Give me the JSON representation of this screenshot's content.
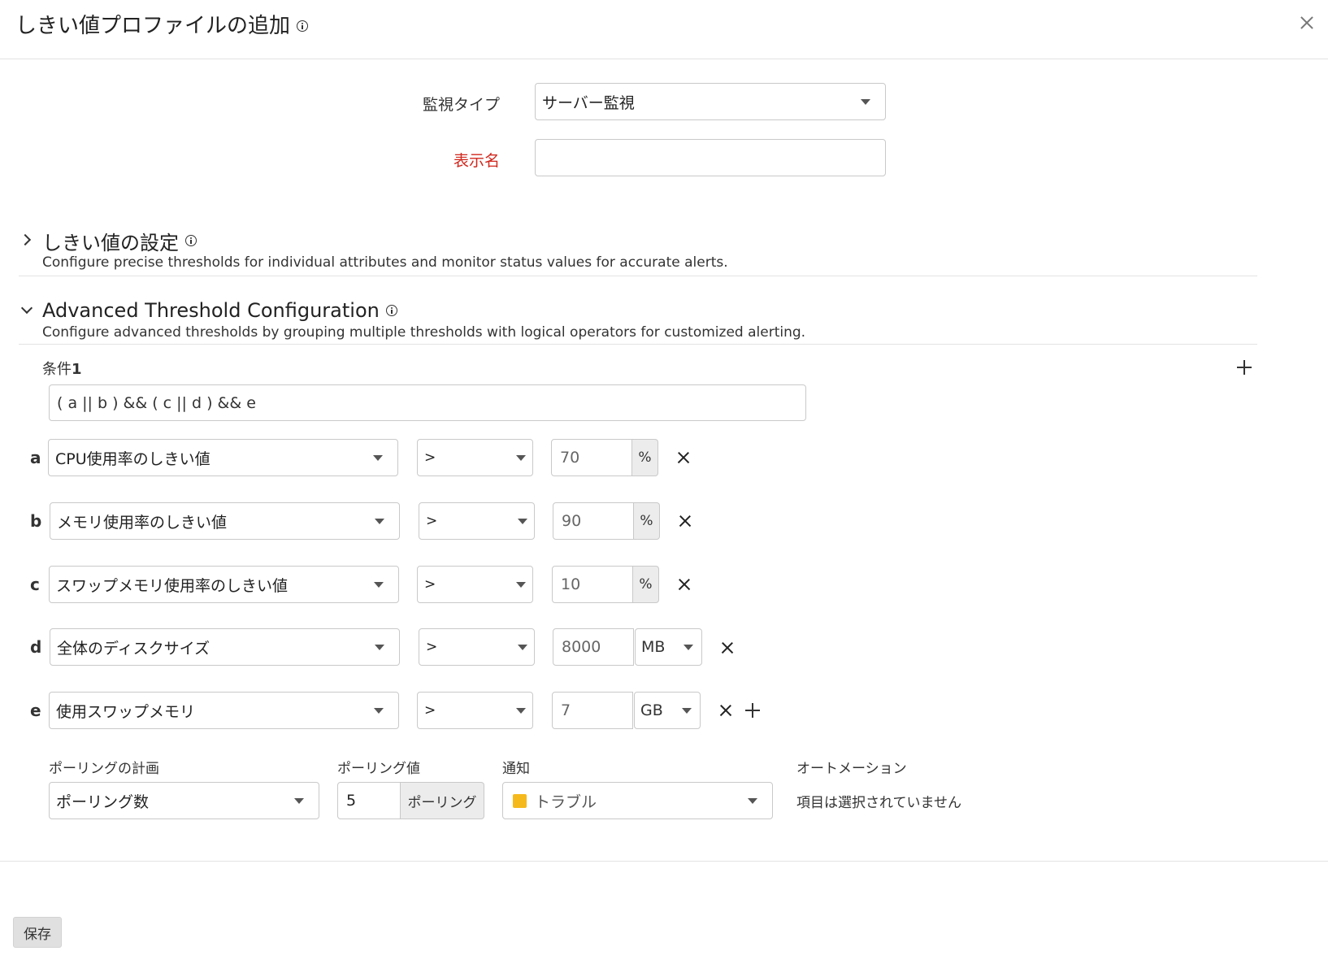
{
  "dialog": {
    "title": "しきい値プロファイルの追加",
    "close_icon": "close-icon"
  },
  "form": {
    "monitor_type_label": "監視タイプ",
    "monitor_type_value": "サーバー監視",
    "display_name_label": "表示名",
    "display_name_value": "",
    "label_required_color": "#d0261c"
  },
  "sections": {
    "threshold": {
      "title": "しきい値の設定",
      "desc": "Configure precise thresholds for individual attributes and monitor status values for accurate alerts."
    },
    "advanced": {
      "title": "Advanced Threshold Configuration",
      "desc": "Configure advanced thresholds by grouping multiple thresholds with logical operators for customized alerting."
    }
  },
  "condition": {
    "label": "条件",
    "number": "1",
    "expression": "( a || b ) && ( c || d ) && e"
  },
  "rows": [
    {
      "key": "a",
      "attribute": "CPU使用率のしきい値",
      "operator": ">",
      "value": "70",
      "unit": "%"
    },
    {
      "key": "b",
      "attribute": "メモリ使用率のしきい値",
      "operator": ">",
      "value": "90",
      "unit": "%"
    },
    {
      "key": "c",
      "attribute": "スワップメモリ使用率のしきい値",
      "operator": ">",
      "value": "10",
      "unit": "%"
    },
    {
      "key": "d",
      "attribute": "全体のディスクサイズ",
      "operator": ">",
      "value": "8000",
      "unit": "MB"
    },
    {
      "key": "e",
      "attribute": "使用スワップメモリ",
      "operator": ">",
      "value": "7",
      "unit": "GB"
    }
  ],
  "polling": {
    "plan_label": "ポーリングの計画",
    "plan_value": "ポーリング数",
    "value_label": "ポーリング値",
    "value": "5",
    "value_unit": "ポーリング",
    "notify_label": "通知",
    "notify_value": "トラブル",
    "notify_color": "#f5b91b",
    "automation_label": "オートメーション",
    "automation_value": "項目は選択されていません"
  },
  "footer": {
    "save_label": "保存"
  }
}
